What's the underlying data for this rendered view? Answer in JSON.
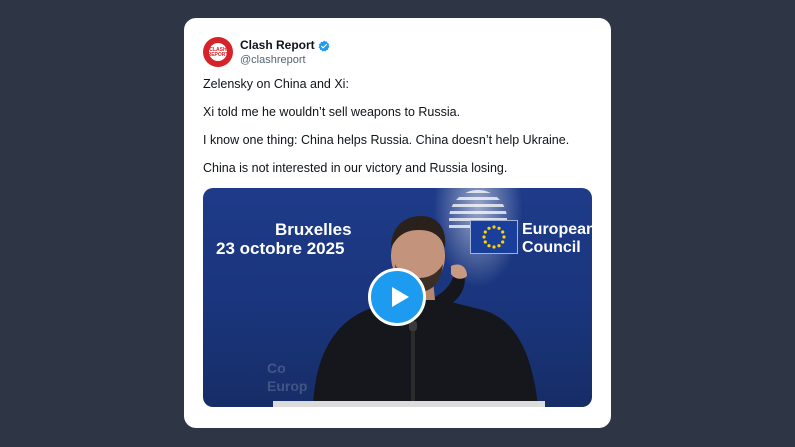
{
  "tweet": {
    "author": {
      "name": "Clash Report",
      "handle": "@clashreport",
      "avatar_text": "CLASH REPORT",
      "verified": true
    },
    "paragraphs": [
      "Zelensky on China and Xi:",
      "Xi told me he wouldn’t sell weapons to Russia.",
      "I know one thing: China helps Russia. China doesn’t help Ukraine.",
      "China is not interested in our victory and Russia losing."
    ],
    "media": {
      "type": "video",
      "backdrop_left_line1": "Bruxelles",
      "backdrop_left_line2": "23 octobre 2025",
      "backdrop_right_line1": "European",
      "backdrop_right_line2": "Council",
      "backdrop_bottom_line1": "Co",
      "backdrop_bottom_line2": "Europ",
      "play_icon": "play-icon"
    }
  },
  "colors": {
    "background": "#2e3544",
    "card": "#ffffff",
    "brand_red": "#d6232a",
    "verified_blue": "#1d9bf0",
    "backdrop_blue": "#1e3b89"
  }
}
